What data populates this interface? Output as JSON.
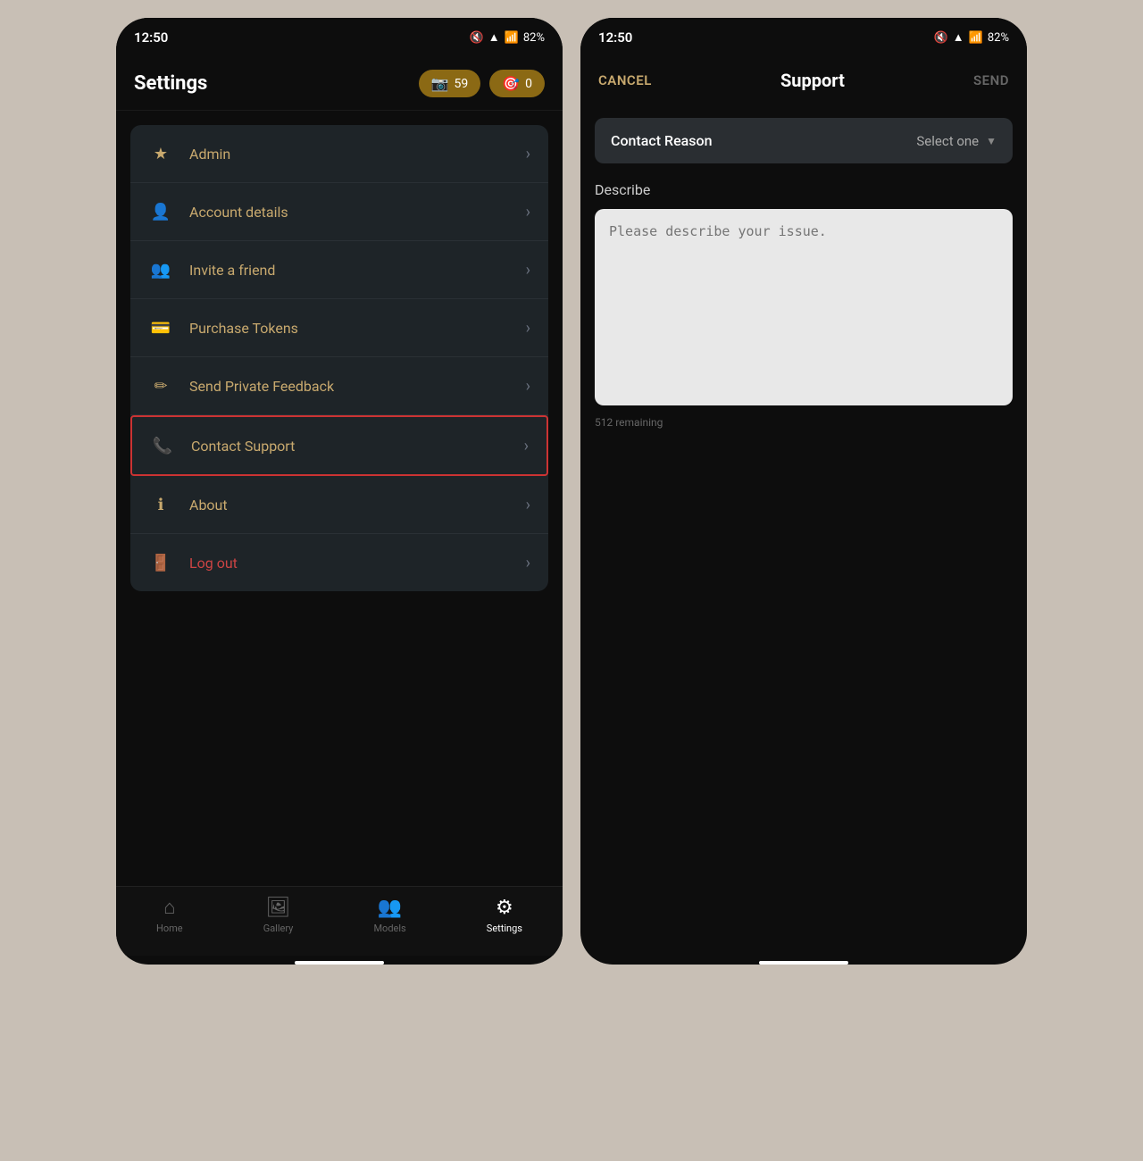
{
  "left_phone": {
    "status_bar": {
      "time": "12:50",
      "battery": "82%"
    },
    "header": {
      "title": "Settings",
      "badge1": {
        "icon": "📷",
        "count": "59"
      },
      "badge2": {
        "icon": "🎯",
        "count": "0"
      }
    },
    "menu_items": [
      {
        "id": "admin",
        "icon": "★",
        "label": "Admin",
        "color": "normal"
      },
      {
        "id": "account",
        "icon": "👤",
        "label": "Account details",
        "color": "normal"
      },
      {
        "id": "invite",
        "icon": "👥",
        "label": "Invite a friend",
        "color": "normal"
      },
      {
        "id": "tokens",
        "icon": "💳",
        "label": "Purchase Tokens",
        "color": "normal"
      },
      {
        "id": "feedback",
        "icon": "✏️",
        "label": "Send Private Feedback",
        "color": "normal"
      },
      {
        "id": "support",
        "icon": "📞",
        "label": "Contact Support",
        "color": "normal",
        "highlighted": true
      },
      {
        "id": "about",
        "icon": "ℹ️",
        "label": "About",
        "color": "normal"
      },
      {
        "id": "logout",
        "icon": "🚪",
        "label": "Log out",
        "color": "logout"
      }
    ],
    "bottom_nav": [
      {
        "id": "home",
        "icon": "⌂",
        "label": "Home",
        "active": false
      },
      {
        "id": "gallery",
        "icon": "🖼",
        "label": "Gallery",
        "active": false
      },
      {
        "id": "models",
        "icon": "👥",
        "label": "Models",
        "active": false
      },
      {
        "id": "settings",
        "icon": "⚙",
        "label": "Settings",
        "active": true
      }
    ]
  },
  "right_phone": {
    "status_bar": {
      "time": "12:50",
      "battery": "82%"
    },
    "header": {
      "cancel": "CANCEL",
      "title": "Support",
      "send": "SEND"
    },
    "contact_reason": {
      "label": "Contact Reason",
      "placeholder": "Select one"
    },
    "describe": {
      "label": "Describe",
      "placeholder": "Please describe your issue.",
      "remaining": "512 remaining"
    }
  }
}
